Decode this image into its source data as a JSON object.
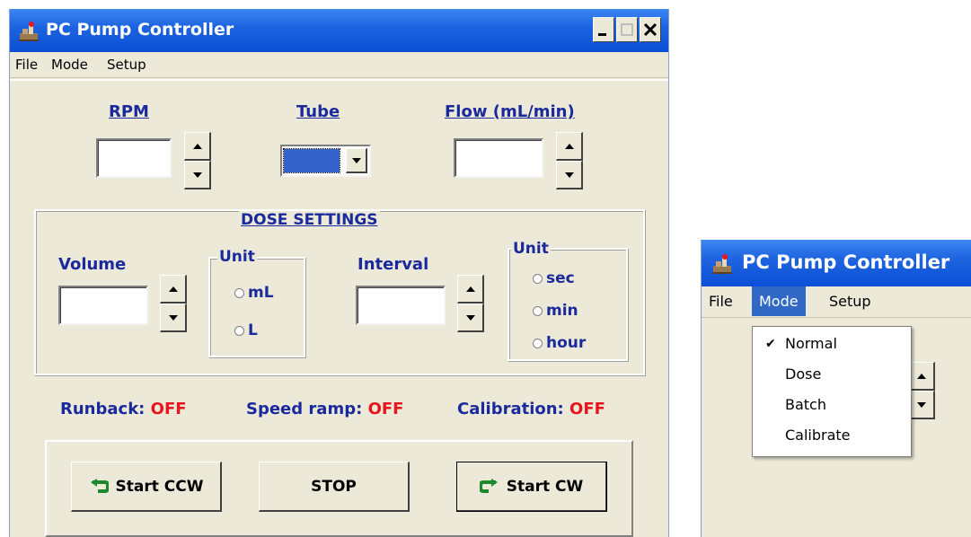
{
  "main_window": {
    "title": "PC Pump Controller",
    "menu": [
      "File",
      "Mode",
      "Setup"
    ],
    "rpm_label": "RPM",
    "tube_label": "Tube",
    "flow_label": "Flow (mL/min)",
    "rpm_value": "",
    "flow_value": "",
    "dose": {
      "title": "DOSE SETTINGS",
      "volume_label": "Volume",
      "volume_value": "",
      "unit_label": "Unit",
      "unit_options": [
        "mL",
        "L"
      ],
      "interval_label": "Interval",
      "interval_value": "",
      "interval_unit_label": "Unit",
      "interval_unit_options": [
        "sec",
        "min",
        "hour"
      ]
    },
    "status": {
      "runback_label": "Runback:",
      "runback_value": "OFF",
      "speed_ramp_label": "Speed ramp:",
      "speed_ramp_value": "OFF",
      "calibration_label": "Calibration:",
      "calibration_value": "OFF"
    },
    "buttons": {
      "start_ccw": "Start CCW",
      "stop": "STOP",
      "start_cw": "Start CW"
    }
  },
  "second_window": {
    "title": "PC Pump Controller",
    "menu": [
      "File",
      "Mode",
      "Setup"
    ],
    "active_menu": "Mode",
    "mode_menu": {
      "items": [
        "Normal",
        "Dose",
        "Batch",
        "Calibrate"
      ],
      "checked": "Normal"
    }
  },
  "colors": {
    "title_bar": "#0a4fd6",
    "label_blue": "#1a2a9c",
    "off_red": "#e8141c",
    "window_bg": "#ece9d8",
    "menu_highlight": "#3168c5"
  }
}
